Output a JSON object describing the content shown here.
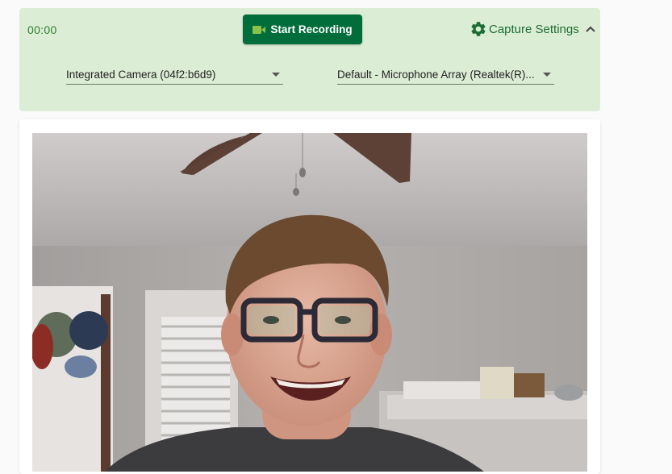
{
  "toolbar": {
    "timer": "00:00",
    "record_label": "Start Recording",
    "settings_label": "Capture Settings",
    "camera_select": "Integrated Camera (04f2:b6d9)",
    "mic_select": "Default - Microphone Array (Realtek(R)..."
  },
  "colors": {
    "toolbar_bg": "#dcedd5",
    "accent": "#006d3a",
    "accent_text": "#1b6e33"
  },
  "icons": {
    "record": "video-camera-icon",
    "settings": "gear-icon",
    "collapse": "chevron-up-icon"
  }
}
